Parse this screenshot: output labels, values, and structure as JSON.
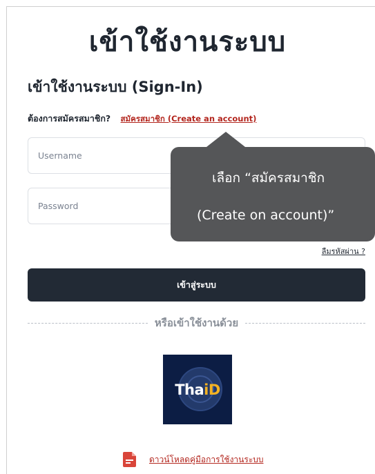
{
  "page": {
    "title": "เข้าใช้งานระบบ",
    "subtitle": "เข้าใช้งานระบบ (Sign-In)"
  },
  "register": {
    "prompt": "ต้องการสมัครสมาชิก?",
    "link_label": "สมัครสมาชิก (Create an account)"
  },
  "form": {
    "username_placeholder": "Username",
    "password_placeholder": "Password",
    "forgot_label": "ลืมรหัสผ่าน ?",
    "login_label": "เข้าสู่ระบบ"
  },
  "alt_login": {
    "divider_text": "หรือเข้าใช้งานด้วย",
    "thaid_text_1": "Tha",
    "thaid_text_2": "iD"
  },
  "manual": {
    "label": "ดาวน์โหลดคู่มือการใช้งานระบบ",
    "icon": "pdf-document-icon"
  },
  "tooltip": {
    "line1": "เลือก “สมัครสมาชิก",
    "line2": "(Create on account)”"
  },
  "colors": {
    "primary_dark": "#222a35",
    "link_red": "#b3261e",
    "tooltip_bg": "#555658",
    "thaid_bg": "#0c1d44",
    "thaid_accent": "#f4b223"
  }
}
